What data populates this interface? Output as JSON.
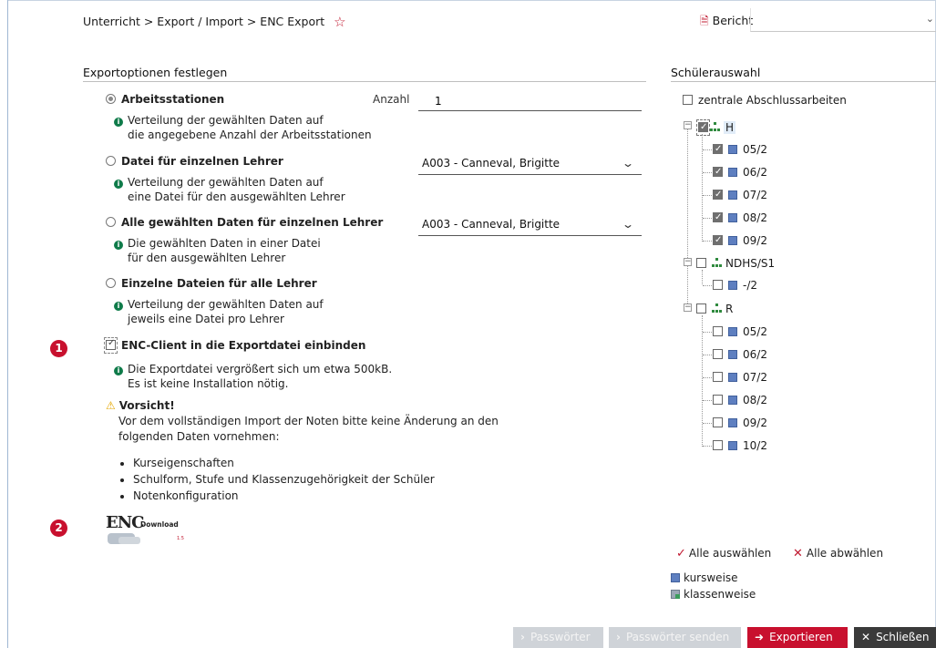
{
  "header": {
    "breadcrumb": "Unterricht > Export / Import > ENC Export",
    "report_label": "Bericht",
    "report_value": ""
  },
  "export": {
    "title": "Exportoptionen festlegen",
    "options": [
      {
        "label": "Arbeitsstationen",
        "selected": true,
        "info": [
          "Verteilung der gewählten Daten auf",
          "die angegebene Anzahl der Arbeitsstationen"
        ]
      },
      {
        "label": "Datei für einzelnen Lehrer",
        "selected": false,
        "info": [
          "Verteilung der gewählten Daten auf",
          "eine Datei für den ausgewählten Lehrer"
        ]
      },
      {
        "label": "Alle gewählten Daten für einzelnen Lehrer",
        "selected": false,
        "info": [
          "Die gewählten Daten in einer Datei",
          "für den ausgewählten Lehrer"
        ]
      },
      {
        "label": "Einzelne Dateien für alle Lehrer",
        "selected": false,
        "info": [
          "Verteilung der gewählten Daten auf",
          "jeweils eine Datei pro Lehrer"
        ]
      }
    ],
    "anzahl_label": "Anzahl",
    "anzahl_value": "1",
    "teacher_select_1": "A003 - Canneval, Brigitte",
    "teacher_select_2": "A003 - Canneval, Brigitte",
    "enc_client": {
      "label": "ENC-Client in die Exportdatei einbinden",
      "checked": true,
      "info": [
        "Die Exportdatei vergrößert sich um etwa 500kB.",
        "Es ist keine Installation nötig."
      ]
    },
    "warning": {
      "title": "Vorsicht!",
      "text": [
        "Vor dem vollständigen Import der Noten bitte keine Änderung an den",
        "folgenden Daten vornehmen:"
      ],
      "items": [
        "Kurseigenschaften",
        "Schulform, Stufe und Klassenzugehörigkeit der Schüler",
        "Notenkonfiguration"
      ]
    },
    "markers": [
      "1",
      "2"
    ],
    "logo": {
      "main": "ENC",
      "sub": "Download",
      "ver": "1.5"
    }
  },
  "students": {
    "title": "Schülerauswahl",
    "zentrale_label": "zentrale Abschlussarbeiten",
    "zentrale_checked": false,
    "groups": [
      {
        "name": "H",
        "checked": true,
        "classes": [
          {
            "name": "05/2",
            "checked": true
          },
          {
            "name": "06/2",
            "checked": true
          },
          {
            "name": "07/2",
            "checked": true
          },
          {
            "name": "08/2",
            "checked": true
          },
          {
            "name": "09/2",
            "checked": true
          }
        ]
      },
      {
        "name": "NDHS/S1",
        "checked": false,
        "classes": [
          {
            "name": "-/2",
            "checked": false
          }
        ]
      },
      {
        "name": "R",
        "checked": false,
        "classes": [
          {
            "name": "05/2",
            "checked": false
          },
          {
            "name": "06/2",
            "checked": false
          },
          {
            "name": "07/2",
            "checked": false
          },
          {
            "name": "08/2",
            "checked": false
          },
          {
            "name": "09/2",
            "checked": false
          },
          {
            "name": "10/2",
            "checked": false
          }
        ]
      }
    ],
    "select_all": "Alle auswählen",
    "deselect_all": "Alle abwählen",
    "legend": [
      "kursweise",
      "klassenweise"
    ]
  },
  "footer": {
    "passwords": "Passwörter",
    "send_passwords": "Passwörter senden",
    "export": "Exportieren",
    "close": "Schließen"
  },
  "colors": {
    "accent": "#c8102e",
    "info_green": "#0f7b4a",
    "class_blue": "#5e7fc0"
  }
}
